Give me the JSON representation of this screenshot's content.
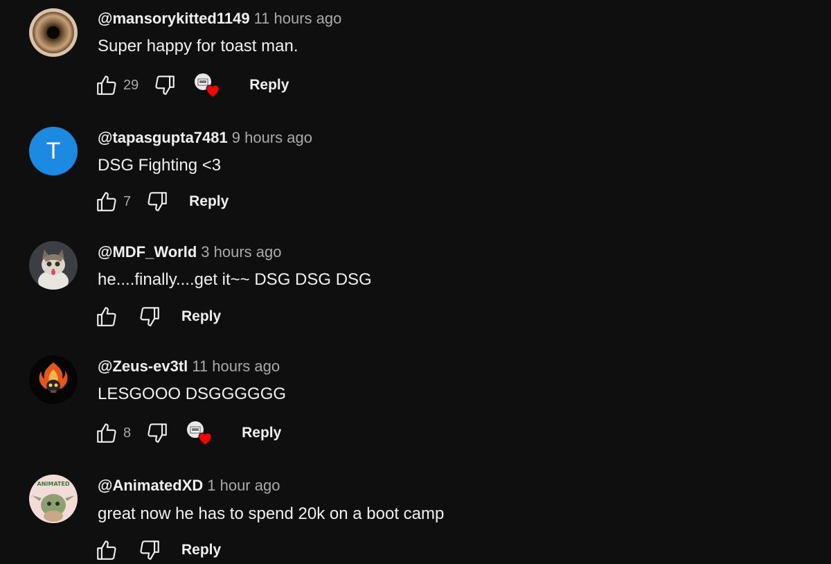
{
  "comments": [
    {
      "author": "@mansorykitted1149",
      "time": "11 hours ago",
      "text": "Super happy for toast man.",
      "likes": "29",
      "hearted": true,
      "reply_label": "Reply"
    },
    {
      "author": "@tapasgupta7481",
      "time": "9 hours ago",
      "text": "DSG Fighting <3",
      "likes": "7",
      "hearted": false,
      "avatar_letter": "T",
      "reply_label": "Reply"
    },
    {
      "author": "@MDF_World",
      "time": "3 hours ago",
      "text": "he....finally....get it~~ DSG DSG DSG",
      "likes": "",
      "hearted": false,
      "reply_label": "Reply"
    },
    {
      "author": "@Zeus-ev3tl",
      "time": "11 hours ago",
      "text": "LESGOOO DSGGGGGG",
      "likes": "8",
      "hearted": true,
      "reply_label": "Reply"
    },
    {
      "author": "@AnimatedXD",
      "time": "1 hour ago",
      "text": "great now he has to spend 20k on a boot camp",
      "likes": "",
      "hearted": false,
      "avatar_logo_text": "ANIMATED",
      "reply_label": "Reply"
    }
  ],
  "colors": {
    "background": "#0f0f0f",
    "text": "#f1f1f1",
    "secondary_text": "#aaaaaa",
    "avatar_blue": "#1c8ae0",
    "heart": "#ff0000"
  }
}
